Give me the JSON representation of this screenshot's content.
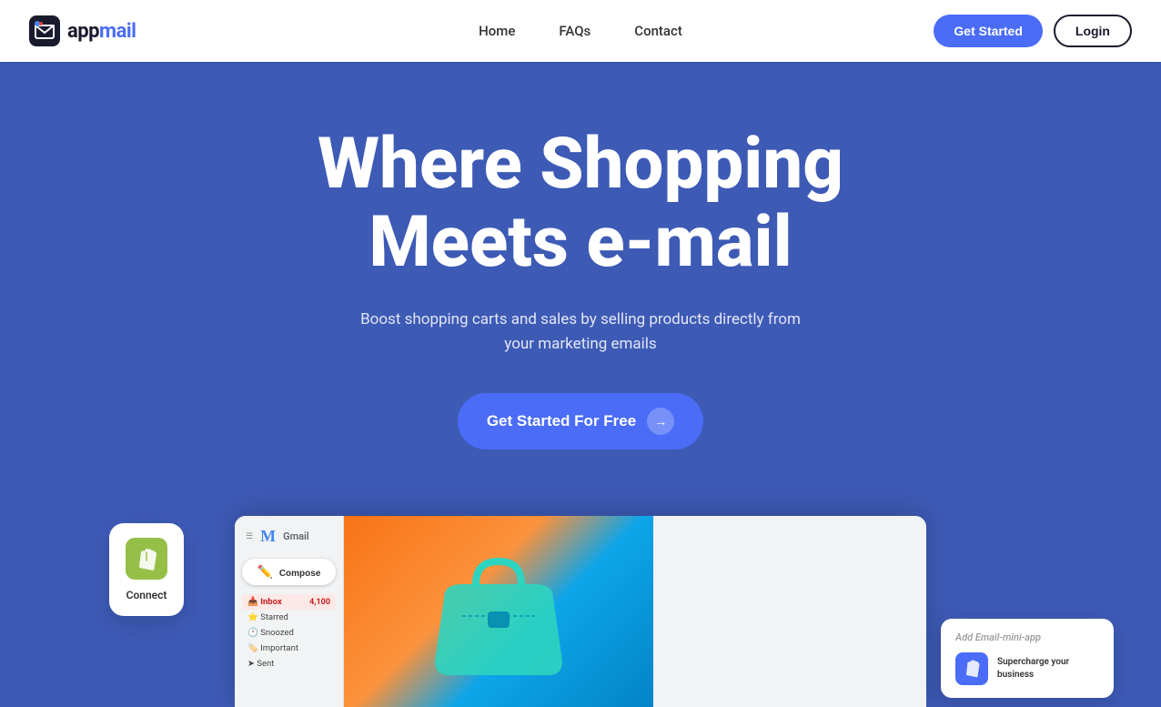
{
  "header": {
    "logo_text_app": "app",
    "logo_text_mail": "mail",
    "nav": {
      "home": "Home",
      "faqs": "FAQs",
      "contact": "Contact"
    },
    "btn_get_started": "Get Started",
    "btn_login": "Login"
  },
  "hero": {
    "title_line1": "Where Shopping",
    "title_line2": "Meets e-mail",
    "subtitle": "Boost shopping carts and sales by selling products directly from your marketing emails",
    "cta_button": "Get Started For Free"
  },
  "shopify_card": {
    "label": "Connect"
  },
  "gmail_mockup": {
    "logo": "Gmail",
    "compose": "Compose",
    "inbox_label": "Inbox",
    "inbox_count": "4,100",
    "starred": "Starred",
    "snoozed": "Snoozed",
    "important": "Important",
    "sent": "Sent"
  },
  "add_app_card": {
    "title_prefix": "Add",
    "title_italic": "Email-mini-app",
    "description": "Supercharge your business"
  },
  "colors": {
    "hero_bg": "#3d5ab5",
    "cta_btn": "#4a6cf7",
    "header_bg": "#ffffff"
  }
}
